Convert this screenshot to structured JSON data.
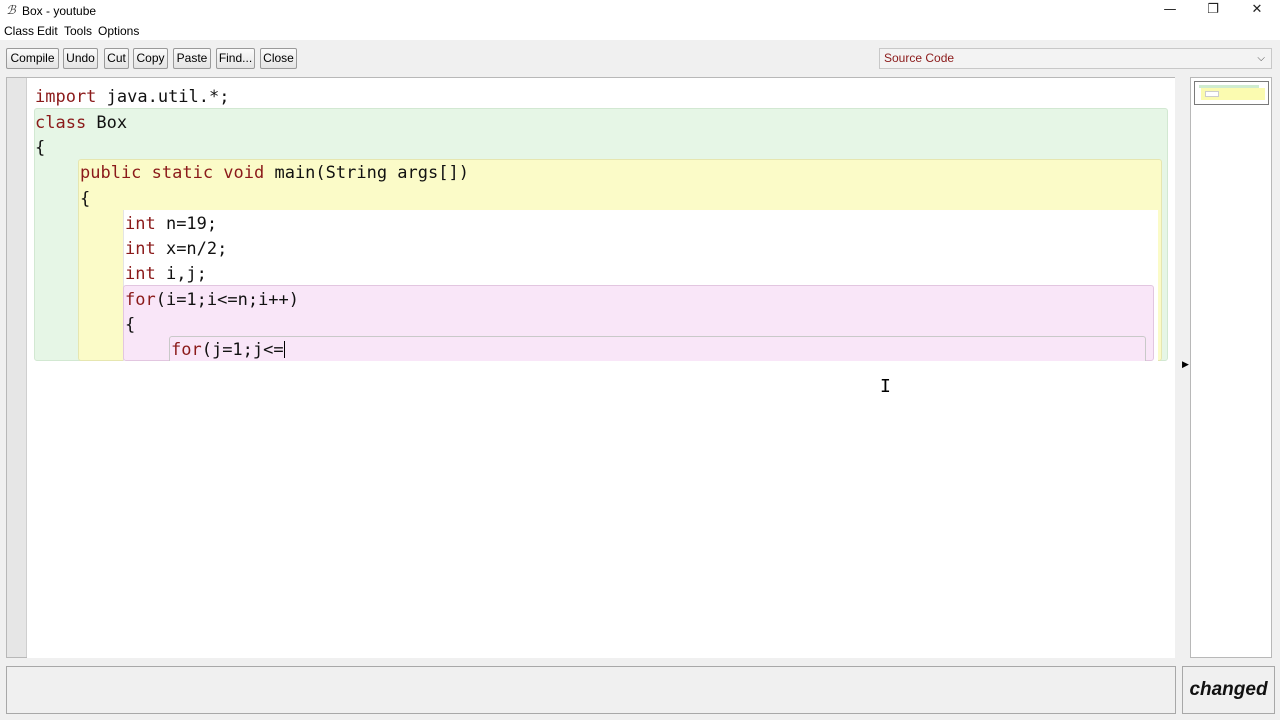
{
  "window": {
    "title": "Box - youtube",
    "icon": "bluej-app-icon",
    "controls": {
      "minimize": "—",
      "restore": "❐",
      "close": "✕"
    }
  },
  "menubar": {
    "items": [
      "Class",
      "Edit",
      "Tools",
      "Options"
    ]
  },
  "toolbar": {
    "buttons": [
      "Compile",
      "Undo",
      "Cut",
      "Copy",
      "Paste",
      "Find...",
      "Close"
    ],
    "view_select": "Source Code"
  },
  "editor": {
    "lines": [
      {
        "kw": "import",
        "rest": " java.util.*;"
      },
      {
        "kw": "class",
        "rest": " Box"
      },
      {
        "kw": "",
        "rest": "{"
      },
      {
        "kw": "public static void",
        "rest": " main(String args[])"
      },
      {
        "kw": "",
        "rest": "{"
      },
      {
        "kw": "int",
        "rest": " n=19;"
      },
      {
        "kw": "int",
        "rest": " x=n/2;"
      },
      {
        "kw": "int",
        "rest": " i,j;"
      },
      {
        "kw": "for",
        "rest": "(i=1;i<=n;i++)"
      },
      {
        "kw": "",
        "rest": "{"
      },
      {
        "kw": "for",
        "rest": "(j=1;j<="
      }
    ]
  },
  "status": {
    "message": "",
    "changed": "changed"
  },
  "colors": {
    "keyword": "#8b1a1a",
    "class_scope": "#e6f6e6",
    "method_scope": "#fbfbc8",
    "loop_scope": "#f9e6f8"
  }
}
